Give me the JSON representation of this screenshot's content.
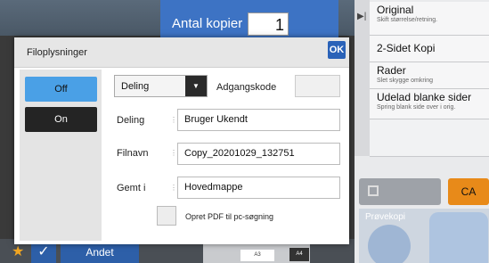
{
  "copies": {
    "label": "Antal kopier",
    "value": "1"
  },
  "right_menu": [
    {
      "title": "Original",
      "subtitle": "Skift størrelse/retning."
    },
    {
      "title": "2-Sidet Kopi",
      "subtitle": ""
    },
    {
      "title": "Rader",
      "subtitle": "Slet skygge omkring"
    },
    {
      "title": "Udelad blanke sider",
      "subtitle": "Spring blank side over i orig."
    }
  ],
  "ca_button": "CA",
  "preview_label": "Prøvekopi",
  "bottom": {
    "andet_label": "Andet",
    "thumb_a3": "A3",
    "thumb_a4": "A4"
  },
  "dialog": {
    "title": "Filoplysninger",
    "ok": "OK",
    "off": "Off",
    "on": "On",
    "sharing_dropdown": "Deling",
    "password_label": "Adgangskode",
    "rows": {
      "deling": {
        "label": "Deling",
        "value": "Bruger Ukendt"
      },
      "filnavn": {
        "label": "Filnavn",
        "value": "Copy_20201029_132751"
      },
      "gemt": {
        "label": "Gemt i",
        "value": "Hovedmappe"
      }
    },
    "pdf_option": "Opret PDF til pc-søgning"
  },
  "colors": {
    "accent": "#2a62b8",
    "off_selected": "#4aa0e6",
    "ca": "#e88a19",
    "copies_bar": "#3d73c4"
  }
}
